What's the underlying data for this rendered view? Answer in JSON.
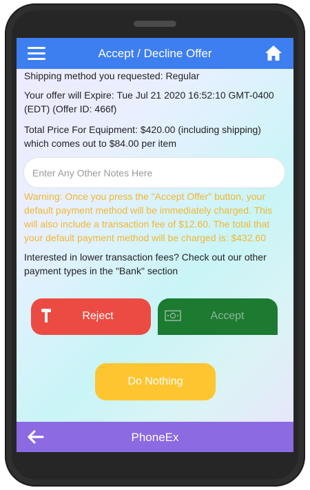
{
  "header": {
    "title": "Accept / Decline Offer",
    "menu_icon": "hamburger-menu-icon",
    "home_icon": "home-icon",
    "color": "#3d7ef0"
  },
  "details": {
    "shipping": "Shipping method you requested: Regular",
    "expire": "Your offer will Expire: Tue Jul 21 2020 16:52:10 GMT-0400 (EDT) (Offer ID: 466f)",
    "price": "Total Price For Equipment: $420.00 (including shipping) which comes out to $84.00 per item"
  },
  "notes": {
    "placeholder": "Enter Any Other Notes Here",
    "value": ""
  },
  "warning": {
    "text": "Warning: Once you press the \"Accept Offer\" button, your default payment method will be immediately charged. This will also include a transaction fee of $12.60. The total that your default payment method will be charged is: $432.60",
    "color": "#f1b731"
  },
  "info": {
    "text": "Interested in lower transaction fees? Check out our other payment types in the \"Bank\" section"
  },
  "buttons": {
    "reject_label": "Reject",
    "reject_color": "#ec4b43",
    "reject_icon": "hammer-icon",
    "accept_label": "Accept",
    "accept_color": "#1c7a31",
    "accept_icon": "money-icon",
    "nothing_label": "Do Nothing",
    "nothing_color": "#fdc530"
  },
  "footer": {
    "title": "PhoneEx",
    "back_icon": "arrow-left-icon",
    "color": "#8b6ae2"
  }
}
